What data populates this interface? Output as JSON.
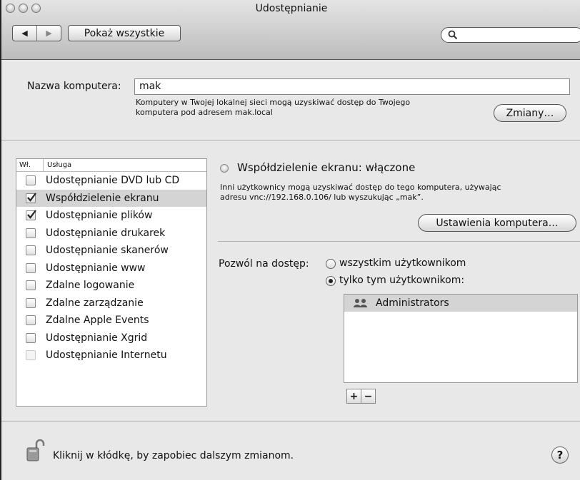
{
  "window": {
    "title": "Udostępnianie"
  },
  "toolbar": {
    "show_all_label": "Pokaż wszystkie",
    "back_glyph": "◀",
    "forward_glyph": "▶",
    "search_value": ""
  },
  "computer_name": {
    "label": "Nazwa komputera:",
    "value": "mak",
    "help_line1": "Komputery w Twojej lokalnej sieci mogą uzyskiwać dostęp do Twojego",
    "help_line2": "komputera pod adresem mak.local",
    "edit_label": "Zmiany…"
  },
  "services": {
    "col_on": "Wł.",
    "col_service": "Usługa",
    "items": [
      {
        "label": "Udostępnianie DVD lub CD",
        "checked": false,
        "enabled": true,
        "selected": false
      },
      {
        "label": "Współdzielenie ekranu",
        "checked": true,
        "enabled": true,
        "selected": true
      },
      {
        "label": "Udostępnianie plików",
        "checked": true,
        "enabled": true,
        "selected": false
      },
      {
        "label": "Udostępnianie drukarek",
        "checked": false,
        "enabled": true,
        "selected": false
      },
      {
        "label": "Udostępnianie skanerów",
        "checked": false,
        "enabled": true,
        "selected": false
      },
      {
        "label": "Udostępnianie www",
        "checked": false,
        "enabled": true,
        "selected": false
      },
      {
        "label": "Zdalne logowanie",
        "checked": false,
        "enabled": true,
        "selected": false
      },
      {
        "label": "Zdalne zarządzanie",
        "checked": false,
        "enabled": true,
        "selected": false
      },
      {
        "label": "Zdalne Apple Events",
        "checked": false,
        "enabled": true,
        "selected": false
      },
      {
        "label": "Udostępnianie Xgrid",
        "checked": false,
        "enabled": true,
        "selected": false
      },
      {
        "label": "Udostępnianie Internetu",
        "checked": false,
        "enabled": false,
        "selected": false
      }
    ]
  },
  "detail": {
    "status_title": "Współdzielenie ekranu: włączone",
    "desc_line1": "Inni użytkownicy mogą uzyskiwać dostęp do tego komputera, używając",
    "desc_line2": "adresu vnc://192.168.0.106/ lub wyszukując „mak”.",
    "computer_settings_label": "Ustawienia komputera…",
    "allow_access_label": "Pozwól na dostęp:",
    "radio_all": "wszystkim użytkownikom",
    "radio_only": "tylko tym użytkownikom:",
    "selected_radio": "only",
    "users": [
      "Administrators"
    ],
    "add_label": "+",
    "remove_label": "−"
  },
  "footer": {
    "lock_text": "Kliknij w kłódkę, by zapobiec dalszym zmianom.",
    "help_label": "?"
  }
}
